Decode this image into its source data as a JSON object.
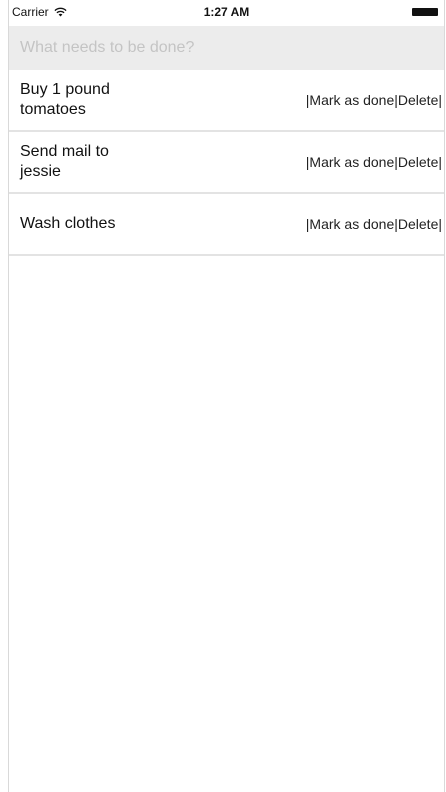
{
  "status_bar": {
    "carrier": "Carrier",
    "wifi_icon": "wifi-icon",
    "time": "1:27 AM",
    "battery_icon": "battery-icon"
  },
  "input": {
    "placeholder": "What needs to be done?",
    "value": ""
  },
  "todos": [
    {
      "text": "Buy 1 pound tomatoes",
      "mark_done_label": "Mark as done",
      "delete_label": "Delete",
      "separator": "|"
    },
    {
      "text": "Send mail to jessie",
      "mark_done_label": "Mark as done",
      "delete_label": "Delete",
      "separator": "|"
    },
    {
      "text": "Wash clothes",
      "mark_done_label": "Mark as done",
      "delete_label": "Delete",
      "separator": "|"
    }
  ]
}
